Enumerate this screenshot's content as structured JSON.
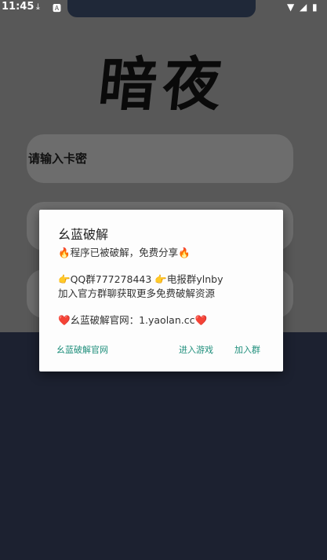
{
  "status_bar": {
    "time": "11:45",
    "left_icons": [
      "download-icon",
      "a-notification-icon"
    ],
    "right_icons": [
      "wifi-icon",
      "signal-icon",
      "battery-icon"
    ]
  },
  "app": {
    "logo_text": "暗夜",
    "card_key_placeholder": "请输入卡密"
  },
  "dialog": {
    "title": "幺蓝破解",
    "line1": "🔥程序已被破解，免费分享🔥",
    "line2": "👉QQ群777278443 👉电报群ylnby",
    "line3": "加入官方群聊获取更多免费破解资源",
    "line4": "❤️幺蓝破解官网：1.yaolan.cc❤️",
    "buttons": {
      "site": "幺蓝破解官网",
      "enter": "进入游戏",
      "join": "加入群"
    },
    "accent_color": "#1f8f7c"
  }
}
